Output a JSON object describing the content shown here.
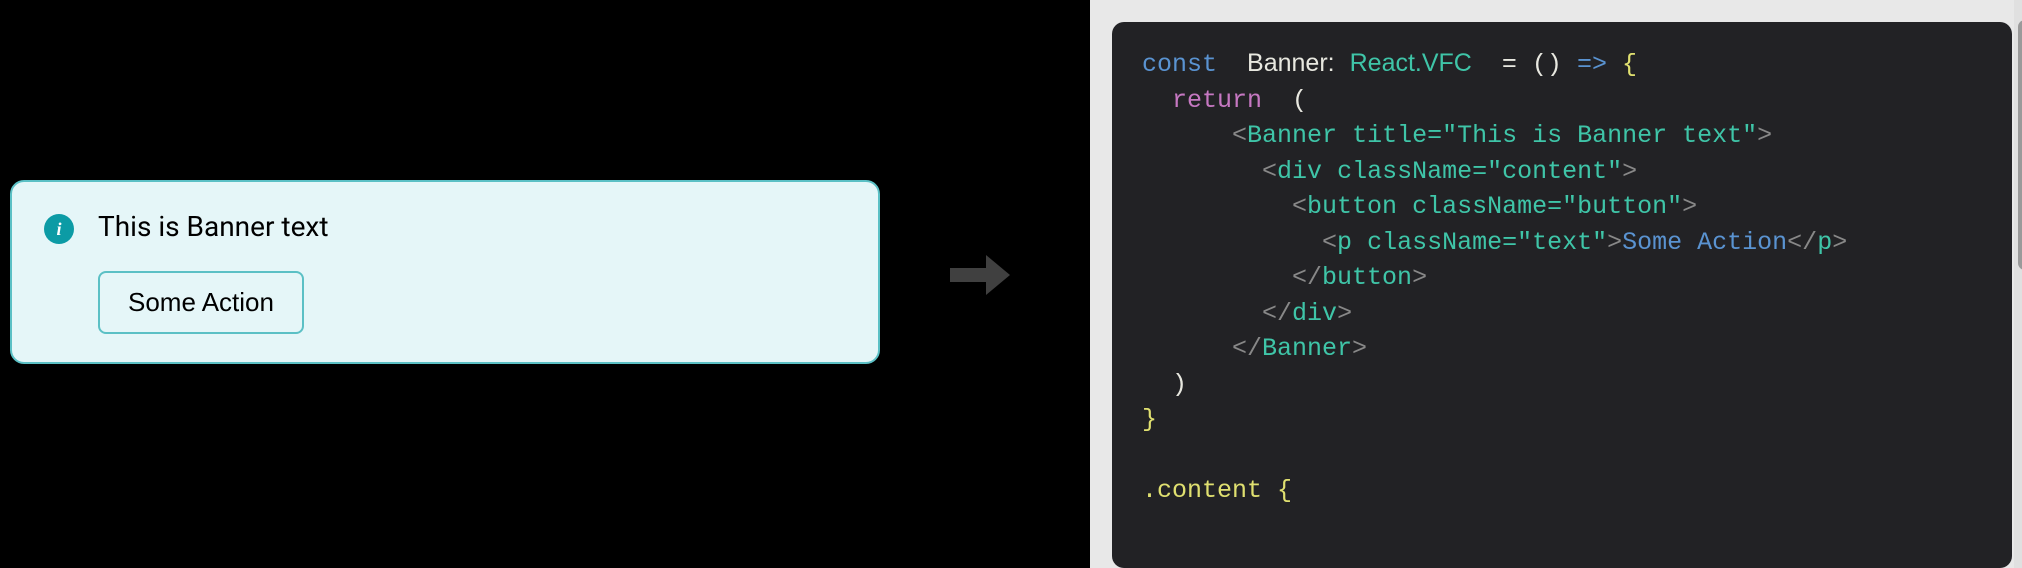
{
  "banner": {
    "text": "This is Banner text",
    "action_label": "Some Action"
  },
  "code": {
    "line1": {
      "const": "const",
      "name": "Banner:",
      "type": "React.VFC",
      "eq": "=",
      "parens": "()",
      "arrow": "=>",
      "brace": "{"
    },
    "line2": {
      "return": "return",
      "paren": "("
    },
    "line3": {
      "open": "<",
      "tag": "Banner",
      "attr": "title=",
      "string": "\"This is Banner text\"",
      "close": ">"
    },
    "line4": {
      "open": "<",
      "tag": "div",
      "attr": "className=",
      "string": "\"content\"",
      "close": ">"
    },
    "line5": {
      "open": "<",
      "tag": "button",
      "attr": "className=",
      "string": "\"button\"",
      "close": ">"
    },
    "line6": {
      "open": "<",
      "tag": "p",
      "attr": "className=",
      "string": "\"text\"",
      "close": ">",
      "text": "Some Action",
      "close_open": "</",
      "close_tag": "p",
      "close_angle": ">"
    },
    "line7": {
      "open": "</",
      "tag": "button",
      "close": ">"
    },
    "line8": {
      "open": "</",
      "tag": "div",
      "close": ">"
    },
    "line9": {
      "open": "</",
      "tag": "Banner",
      "close": ">"
    },
    "line10": {
      "paren": ")"
    },
    "line11": {
      "brace": "}"
    },
    "line13": {
      "sel": ".content",
      "brace": "{"
    }
  }
}
